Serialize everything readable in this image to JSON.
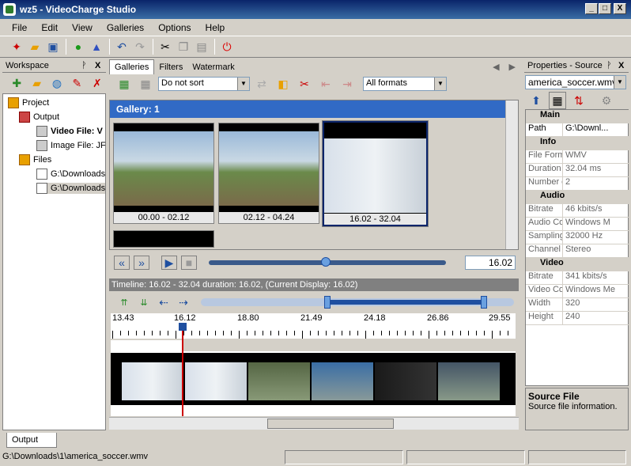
{
  "window": {
    "title": "wz5 - VideoCharge Studio",
    "min": "_",
    "max": "□",
    "close": "X"
  },
  "menu": [
    "File",
    "Edit",
    "View",
    "Galleries",
    "Options",
    "Help"
  ],
  "workspace": {
    "title": "Workspace",
    "pin": "ᚹ",
    "close": "X",
    "tree": {
      "project": "Project",
      "output": "Output",
      "video_file": "Video File: V",
      "image_file": "Image File: JF",
      "files": "Files",
      "file1": "G:\\Downloads",
      "file2": "G:\\Downloads"
    }
  },
  "tabs": [
    "Galleries",
    "Filters",
    "Watermark"
  ],
  "gallery": {
    "sort": "Do not sort",
    "formats": "All formats",
    "header": "Gallery: 1",
    "thumbs": [
      "00.00 - 02.12",
      "02.12 - 04.24",
      "16.02 - 32.04"
    ],
    "position": "16.02"
  },
  "timeline": {
    "info": "Timeline: 16.02 - 32.04 duration: 16.02, (Current Display: 16.02)",
    "ticks": [
      "13.43",
      "16.12",
      "18.80",
      "21.49",
      "24.18",
      "26.86",
      "29.55"
    ]
  },
  "properties": {
    "title": "Properties - Source",
    "pin": "ᚹ",
    "close": "X",
    "source": "america_soccer.wmv",
    "main": "Main",
    "path_k": "Path",
    "path_v": "G:\\Downl...",
    "info": "Info",
    "fmt_k": "File Form",
    "fmt_v": "WMV",
    "dur_k": "Duration",
    "dur_v": "32.04 ms",
    "num_k": "Number c",
    "num_v": "2",
    "audio": "Audio",
    "abr_k": "Bitrate",
    "abr_v": "46 kbits/s",
    "aco_k": "Audio Co",
    "aco_v": "Windows M",
    "smp_k": "Sampling",
    "smp_v": "32000 Hz",
    "ch_k": "Channel I",
    "ch_v": "Stereo",
    "video": "Video",
    "vbr_k": "Bitrate",
    "vbr_v": "341 kbits/s",
    "vco_k": "Video Co",
    "vco_v": "Windows Me",
    "w_k": "Width",
    "w_v": "320",
    "h_k": "Height",
    "h_v": "240",
    "desc_title": "Source File",
    "desc_text": "Source file information."
  },
  "bottom_tab": "Output",
  "status": "G:\\Downloads\\1\\america_soccer.wmv",
  "colors": {
    "title_start": "#0a246a",
    "title_end": "#3a6ea5",
    "gallery_header": "#316ac5",
    "playhead": "#cc0000"
  }
}
